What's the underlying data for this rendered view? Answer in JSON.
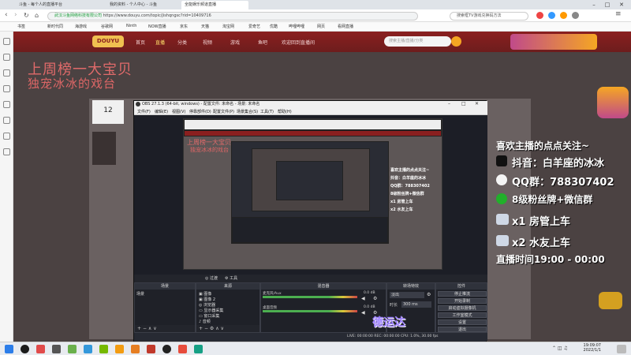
{
  "browser": {
    "tabs": [
      {
        "label": "斗鱼 - 每个人的直播平台"
      },
      {
        "label": "我的资料 - 个人中心 - 斗鱼"
      },
      {
        "label": "全能娱乐频道直播"
      }
    ],
    "address": {
      "site_label": "武汉斗鱼网络科技有限公司",
      "url": "https://www.douyu.com/topic/jishqngsc?rid=10409716"
    },
    "search_placeholder": "搜索框TV游戏兑换码方法",
    "bookmarks": [
      "书签",
      "新时代同",
      "海游戏",
      "谷歌网",
      "Ninth",
      "NOW直播",
      "京东",
      "天猫",
      "淘宝网",
      "爱奇艺",
      "优酷",
      "哔哩哔哩",
      "网页",
      "看网直播"
    ]
  },
  "site": {
    "nav": [
      "首页",
      "直播",
      "分类",
      "视频",
      "游戏",
      "鱼吧",
      "欢迎回到直播间"
    ],
    "search_placeholder": "搜索主播/直播/分类"
  },
  "stream": {
    "banner_line1": "上周榜一大宝贝",
    "banner_line2": "独宠冰冰的戏台",
    "viewer_count": "12"
  },
  "promo": {
    "headline": "喜欢主播的点点关注~",
    "douyin": "抖音：白羊座的冰冰",
    "qq": "QQ群：788307402",
    "fans": "8级粉丝牌+微信群",
    "car1": "x1 房管上车",
    "car2": "x2 水友上车",
    "schedule": "直播时间19:00 - 00:00"
  },
  "obs": {
    "title": "OBS 27.1.3 (64-bit, windows) - 配置文件: 未命名 - 场景: 未命名",
    "menu": [
      "文件(F)",
      "编辑(E)",
      "视图(V)",
      "停靠部件(D)",
      "配置文件(P)",
      "场景集合(S)",
      "工具(T)",
      "帮助(H)"
    ],
    "transition_tabs": [
      "◎ 过渡",
      "⚙ 工具"
    ],
    "docks": {
      "scenes": {
        "title": "场景",
        "items": [
          "场景"
        ]
      },
      "sources": {
        "title": "来源",
        "items": [
          "图像",
          "图像 2",
          "浏览器",
          "显示器采集",
          "窗口采集",
          "音频"
        ]
      },
      "mixer": {
        "title": "混音器",
        "rows": [
          {
            "name": "麦克风/Aux",
            "db": "0.0 dB"
          },
          {
            "name": "桌面音频",
            "db": "0.0 dB"
          }
        ]
      },
      "transitions": {
        "title": "转场特效",
        "mode": "淡出",
        "duration_label": "时长",
        "duration": "300 ms"
      },
      "controls": {
        "title": "控件",
        "buttons": [
          "停止推流",
          "开始录制",
          "启动虚拟摄像机",
          "工作室模式",
          "设置",
          "退出"
        ]
      }
    },
    "status": "LIVE: 00:00:00   REC: 00:00:00   CPU: 1.0%, 30.00 fps"
  },
  "taskbar": {
    "clock_time": "19:09:07",
    "clock_date": "2022/1/1"
  }
}
